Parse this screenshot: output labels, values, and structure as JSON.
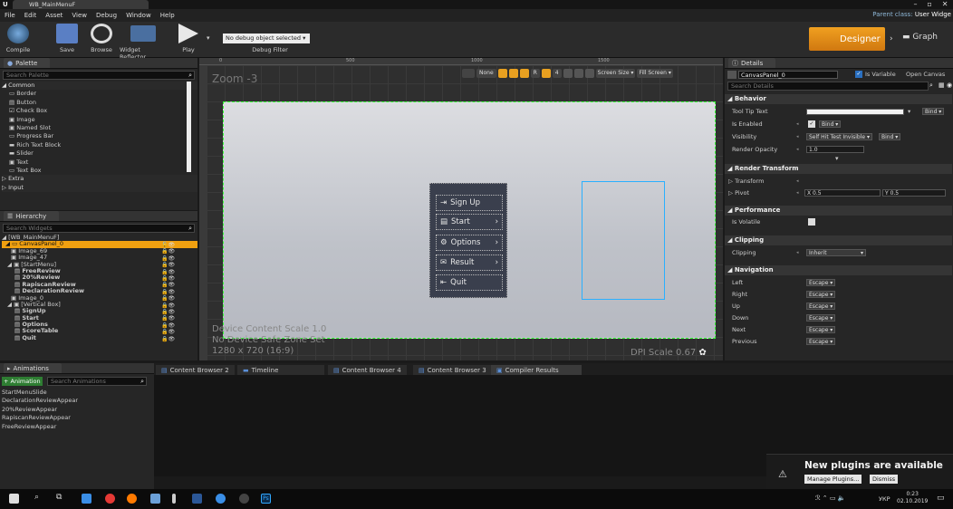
{
  "window": {
    "tab_title": "WB_MainMenuF",
    "parent_class_label": "Parent class:",
    "parent_class": "User Widge"
  },
  "menu": [
    "File",
    "Edit",
    "Asset",
    "View",
    "Debug",
    "Window",
    "Help"
  ],
  "toolbar": {
    "compile": "Compile",
    "save": "Save",
    "browse": "Browse",
    "reflector": "Widget Reflector",
    "play": "Play",
    "debug_select": "No debug object selected ▾",
    "debug_filter": "Debug Filter",
    "designer": "Designer",
    "graph": "Graph"
  },
  "palette": {
    "tab": "Palette",
    "search_placeholder": "Search Palette",
    "common": "◢ Common",
    "items": [
      "▭ Border",
      "▤ Button",
      "☑ Check Box",
      "▣ Image",
      "▣ Named Slot",
      "▭ Progress Bar",
      "▬ Rich Text Block",
      "▬ Slider",
      "▣ Text",
      "▭ Text Box"
    ],
    "extra": "▷ Extra",
    "input": "▷ Input"
  },
  "hierarchy": {
    "tab": "Hierarchy",
    "search_placeholder": "Search Widgets",
    "items": [
      "◢ [WB_MainMenuF]",
      "◢ ▭ CanvasPanel_0",
      "▣ Image_69",
      "▣ Image_47",
      "◢ ▣ [StartMenu]",
      "▤ FreeReview",
      "▤ 20%Review",
      "▤ RapiscanReview",
      "▤ DeclarationReview",
      "▣ Image_0",
      "◢ ▣ [Vertical Box]",
      "▤ SignUp",
      "▤ Start",
      "▤ Options",
      "▤ ScoreTable",
      "▤ Quit"
    ]
  },
  "designer": {
    "zoom": "Zoom -3",
    "ruler_marks": [
      "0",
      "500",
      "1000",
      "1500"
    ],
    "none": "None",
    "r": "R",
    "four": "4",
    "screen_size": "Screen Size ▾",
    "fill_screen": "Fill Screen ▾",
    "info1": "Device Content Scale 1.0",
    "info2": "No Device Safe Zone Set",
    "info3": "1280 x 720 (16:9)",
    "dpi": "DPI Scale 0.67",
    "menu_buttons": [
      "Sign Up",
      "Start",
      "Options",
      "Result",
      "Quit"
    ]
  },
  "details": {
    "tab": "Details",
    "name": "CanvasPanel_0",
    "is_variable": "Is Variable",
    "open_canvas": "Open Canvas",
    "search_placeholder": "Search Details",
    "behavior": "◢ Behavior",
    "tool_tip": "Tool Tip Text",
    "is_enabled": "Is Enabled",
    "visibility": "Visibility",
    "visibility_val": "Self Hit Test Invisible ▾",
    "render_opacity": "Render Opacity",
    "opacity_val": "1.0",
    "bind": "Bind ▾",
    "render_transform": "◢ Render Transform",
    "transform": "▷ Transform",
    "pivot": "▷ Pivot",
    "pivot_x": "X 0.5",
    "pivot_y": "Y 0.5",
    "performance": "◢ Performance",
    "is_volatile": "Is Volatile",
    "clipping_sec": "◢ Clipping",
    "clipping": "Clipping",
    "clipping_val": "Inherit",
    "navigation": "◢ Navigation",
    "nav": [
      "Left",
      "Right",
      "Up",
      "Down",
      "Next",
      "Previous"
    ],
    "escape": "Escape ▾"
  },
  "animations": {
    "tab": "Animations",
    "add": "+ Animation",
    "search_placeholder": "Search Animations",
    "items": [
      "StartMenuSlide",
      "DeclarationReviewAppear",
      "20%ReviewAppear",
      "RapiscanReviewAppear",
      "FreeReviewAppear"
    ]
  },
  "bottom_tabs": [
    "Content Browser 2",
    "Timeline",
    "Content Browser 4",
    "Content Browser 3",
    "Compiler Results"
  ],
  "notify": {
    "title": "New plugins are available",
    "manage": "Manage Plugins...",
    "dismiss": "Dismiss"
  },
  "taskbar": {
    "lang": "УКР",
    "time": "0:23",
    "date": "02.10.2019",
    "ps": "Ps"
  }
}
